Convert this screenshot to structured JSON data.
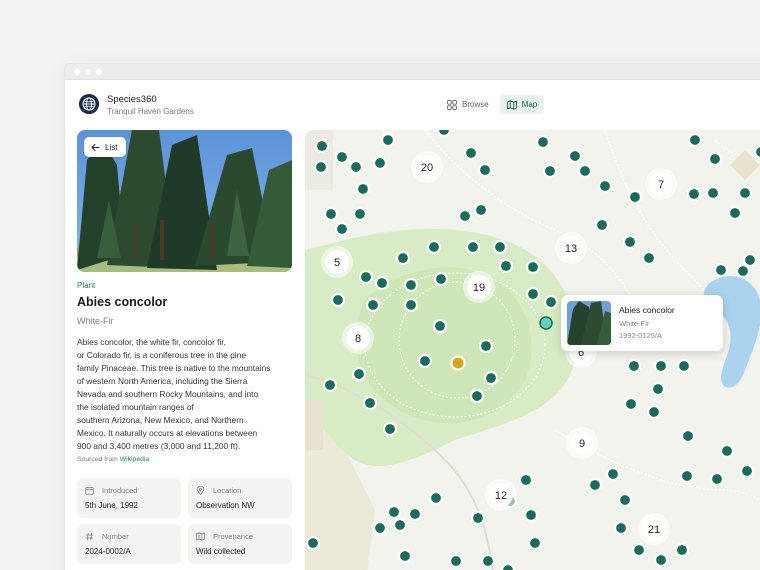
{
  "app": {
    "name": "Species360",
    "subtitle": "Tranquil Haven Gardens"
  },
  "nav": {
    "browse_label": "Browse",
    "map_label": "Map",
    "active": "Map"
  },
  "detail": {
    "back_label": "List",
    "kind": "Plant",
    "title": "Abies concolor",
    "common_name": "White-Fir",
    "description_lines": [
      "Abies concolor, the white fir, concolor fir,",
      "or Colorado fir, is a coniferous tree in the pine",
      "family Pinaceae. This tree is native to the mountains",
      "of western North America, including the Sierra",
      "Nevada and southern Rocky Mountains, and into",
      "the isolated mountain ranges of",
      "southern Arizona, New Mexico, and Northern",
      "Mexico. It naturally occurs at elevations between",
      "900 and 3,400 metres (3,000 and 11,200 ft)."
    ],
    "source_prefix": "Sourced from",
    "source_link": "Wikipedia",
    "facts": {
      "introduced_label": "Introduced",
      "introduced_value": "5th June, 1992",
      "location_label": "Location",
      "location_value": "Observation NW",
      "number_label": "Number",
      "number_value": "2024-0002/A",
      "provenance_label": "Provenance",
      "provenance_value": "Wild collected"
    }
  },
  "map": {
    "clusters": [
      "20",
      "7",
      "13",
      "5",
      "19",
      "8",
      "6",
      "9",
      "12",
      "21"
    ],
    "popup": {
      "title": "Abies concolor",
      "common_name": "White-Fir",
      "accession": "1992-0125/A"
    },
    "colors": {
      "marker": "#1b6b5a",
      "marker_selected": "#5fd3b8",
      "marker_highlight": "#d4a60f",
      "park_green": "#d7ecc4",
      "water": "#a9d3ee"
    }
  },
  "icons": {
    "brand": "globe-icon",
    "browse": "grid-icon",
    "map": "map-icon",
    "back": "arrow-left-icon",
    "introduced": "calendar-icon",
    "location": "location-pin-icon",
    "number": "hash-icon",
    "provenance": "map-icon"
  }
}
